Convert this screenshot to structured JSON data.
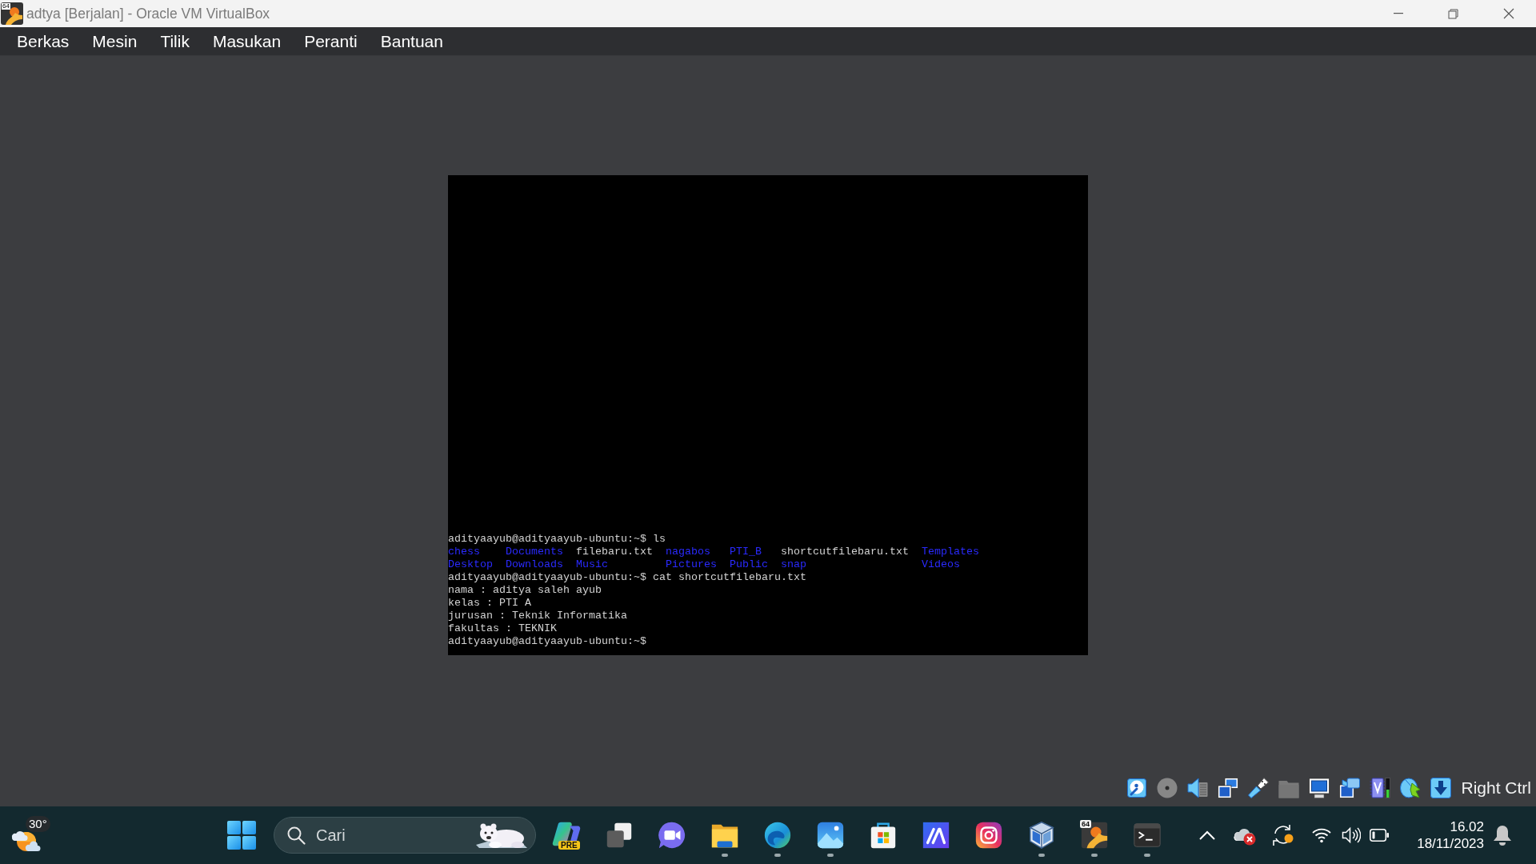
{
  "window": {
    "title": "adtya [Berjalan] - Oracle VM VirtualBox",
    "icon_badge": "64"
  },
  "menu_bar": {
    "items": [
      "Berkas",
      "Mesin",
      "Tilik",
      "Masukan",
      "Peranti",
      "Bantuan"
    ]
  },
  "console": {
    "lines": [
      {
        "kind": "text",
        "text": "adityaayub@adityaayub-ubuntu:~$ ls"
      },
      {
        "kind": "listing",
        "columns": [
          [
            {
              "name": "chess",
              "kind": "directory"
            },
            {
              "name": "Desktop",
              "kind": "directory"
            }
          ],
          [
            {
              "name": "Documents",
              "kind": "directory"
            },
            {
              "name": "Downloads",
              "kind": "directory"
            }
          ],
          [
            {
              "name": "filebaru.txt",
              "kind": "file"
            },
            {
              "name": "Music",
              "kind": "directory"
            }
          ],
          [
            {
              "name": "nagabos",
              "kind": "directory"
            },
            {
              "name": "Pictures",
              "kind": "directory"
            }
          ],
          [
            {
              "name": "PTI_B",
              "kind": "directory"
            },
            {
              "name": "Public",
              "kind": "directory"
            }
          ],
          [
            {
              "name": "shortcutfilebaru.txt",
              "kind": "file"
            },
            {
              "name": "snap",
              "kind": "directory"
            }
          ],
          [
            {
              "name": "Templates",
              "kind": "directory"
            },
            {
              "name": "Videos",
              "kind": "directory"
            }
          ]
        ]
      },
      {
        "kind": "text",
        "text": "adityaayub@adityaayub-ubuntu:~$ cat shortcutfilebaru.txt"
      },
      {
        "kind": "text",
        "text": "nama : aditya saleh ayub"
      },
      {
        "kind": "text",
        "text": "kelas : PTI A"
      },
      {
        "kind": "text",
        "text": "jurusan : Teknik Informatika"
      },
      {
        "kind": "text",
        "text": "fakultas : TEKNIK"
      },
      {
        "kind": "text",
        "text": "adityaayub@adityaayub-ubuntu:~$"
      }
    ]
  },
  "status_bar": {
    "indicators": [
      {
        "kind": "hard-disk",
        "active": true
      },
      {
        "kind": "optical-drive",
        "active": false
      },
      {
        "kind": "audio",
        "active": true
      },
      {
        "kind": "network",
        "active": true
      },
      {
        "kind": "usb",
        "active": true
      },
      {
        "kind": "shared-folders",
        "active": false
      },
      {
        "kind": "display",
        "active": true
      },
      {
        "kind": "recording",
        "active": true
      },
      {
        "kind": "processor",
        "active": true
      },
      {
        "kind": "mouse",
        "active": true
      },
      {
        "kind": "keyboard",
        "active": true
      }
    ],
    "host_key": "Right Ctrl"
  },
  "taskbar": {
    "weather": {
      "temperature": "30°"
    },
    "search": {
      "placeholder": "Cari"
    },
    "apps": [
      {
        "kind": "copilot",
        "badge": "PRE",
        "running": false
      },
      {
        "kind": "task-view",
        "running": false
      },
      {
        "kind": "meet",
        "running": false
      },
      {
        "kind": "files",
        "running": true
      },
      {
        "kind": "browser",
        "running": true
      },
      {
        "kind": "photos",
        "running": true
      },
      {
        "kind": "store",
        "running": false
      },
      {
        "kind": "design",
        "running": false
      },
      {
        "kind": "instagram",
        "running": false
      },
      {
        "kind": "virtualbox",
        "running": true
      },
      {
        "kind": "vm",
        "badge": "64",
        "running": true
      },
      {
        "kind": "terminal",
        "running": true
      }
    ],
    "clock": {
      "time": "16.02",
      "date": "18/11/2023"
    }
  }
}
